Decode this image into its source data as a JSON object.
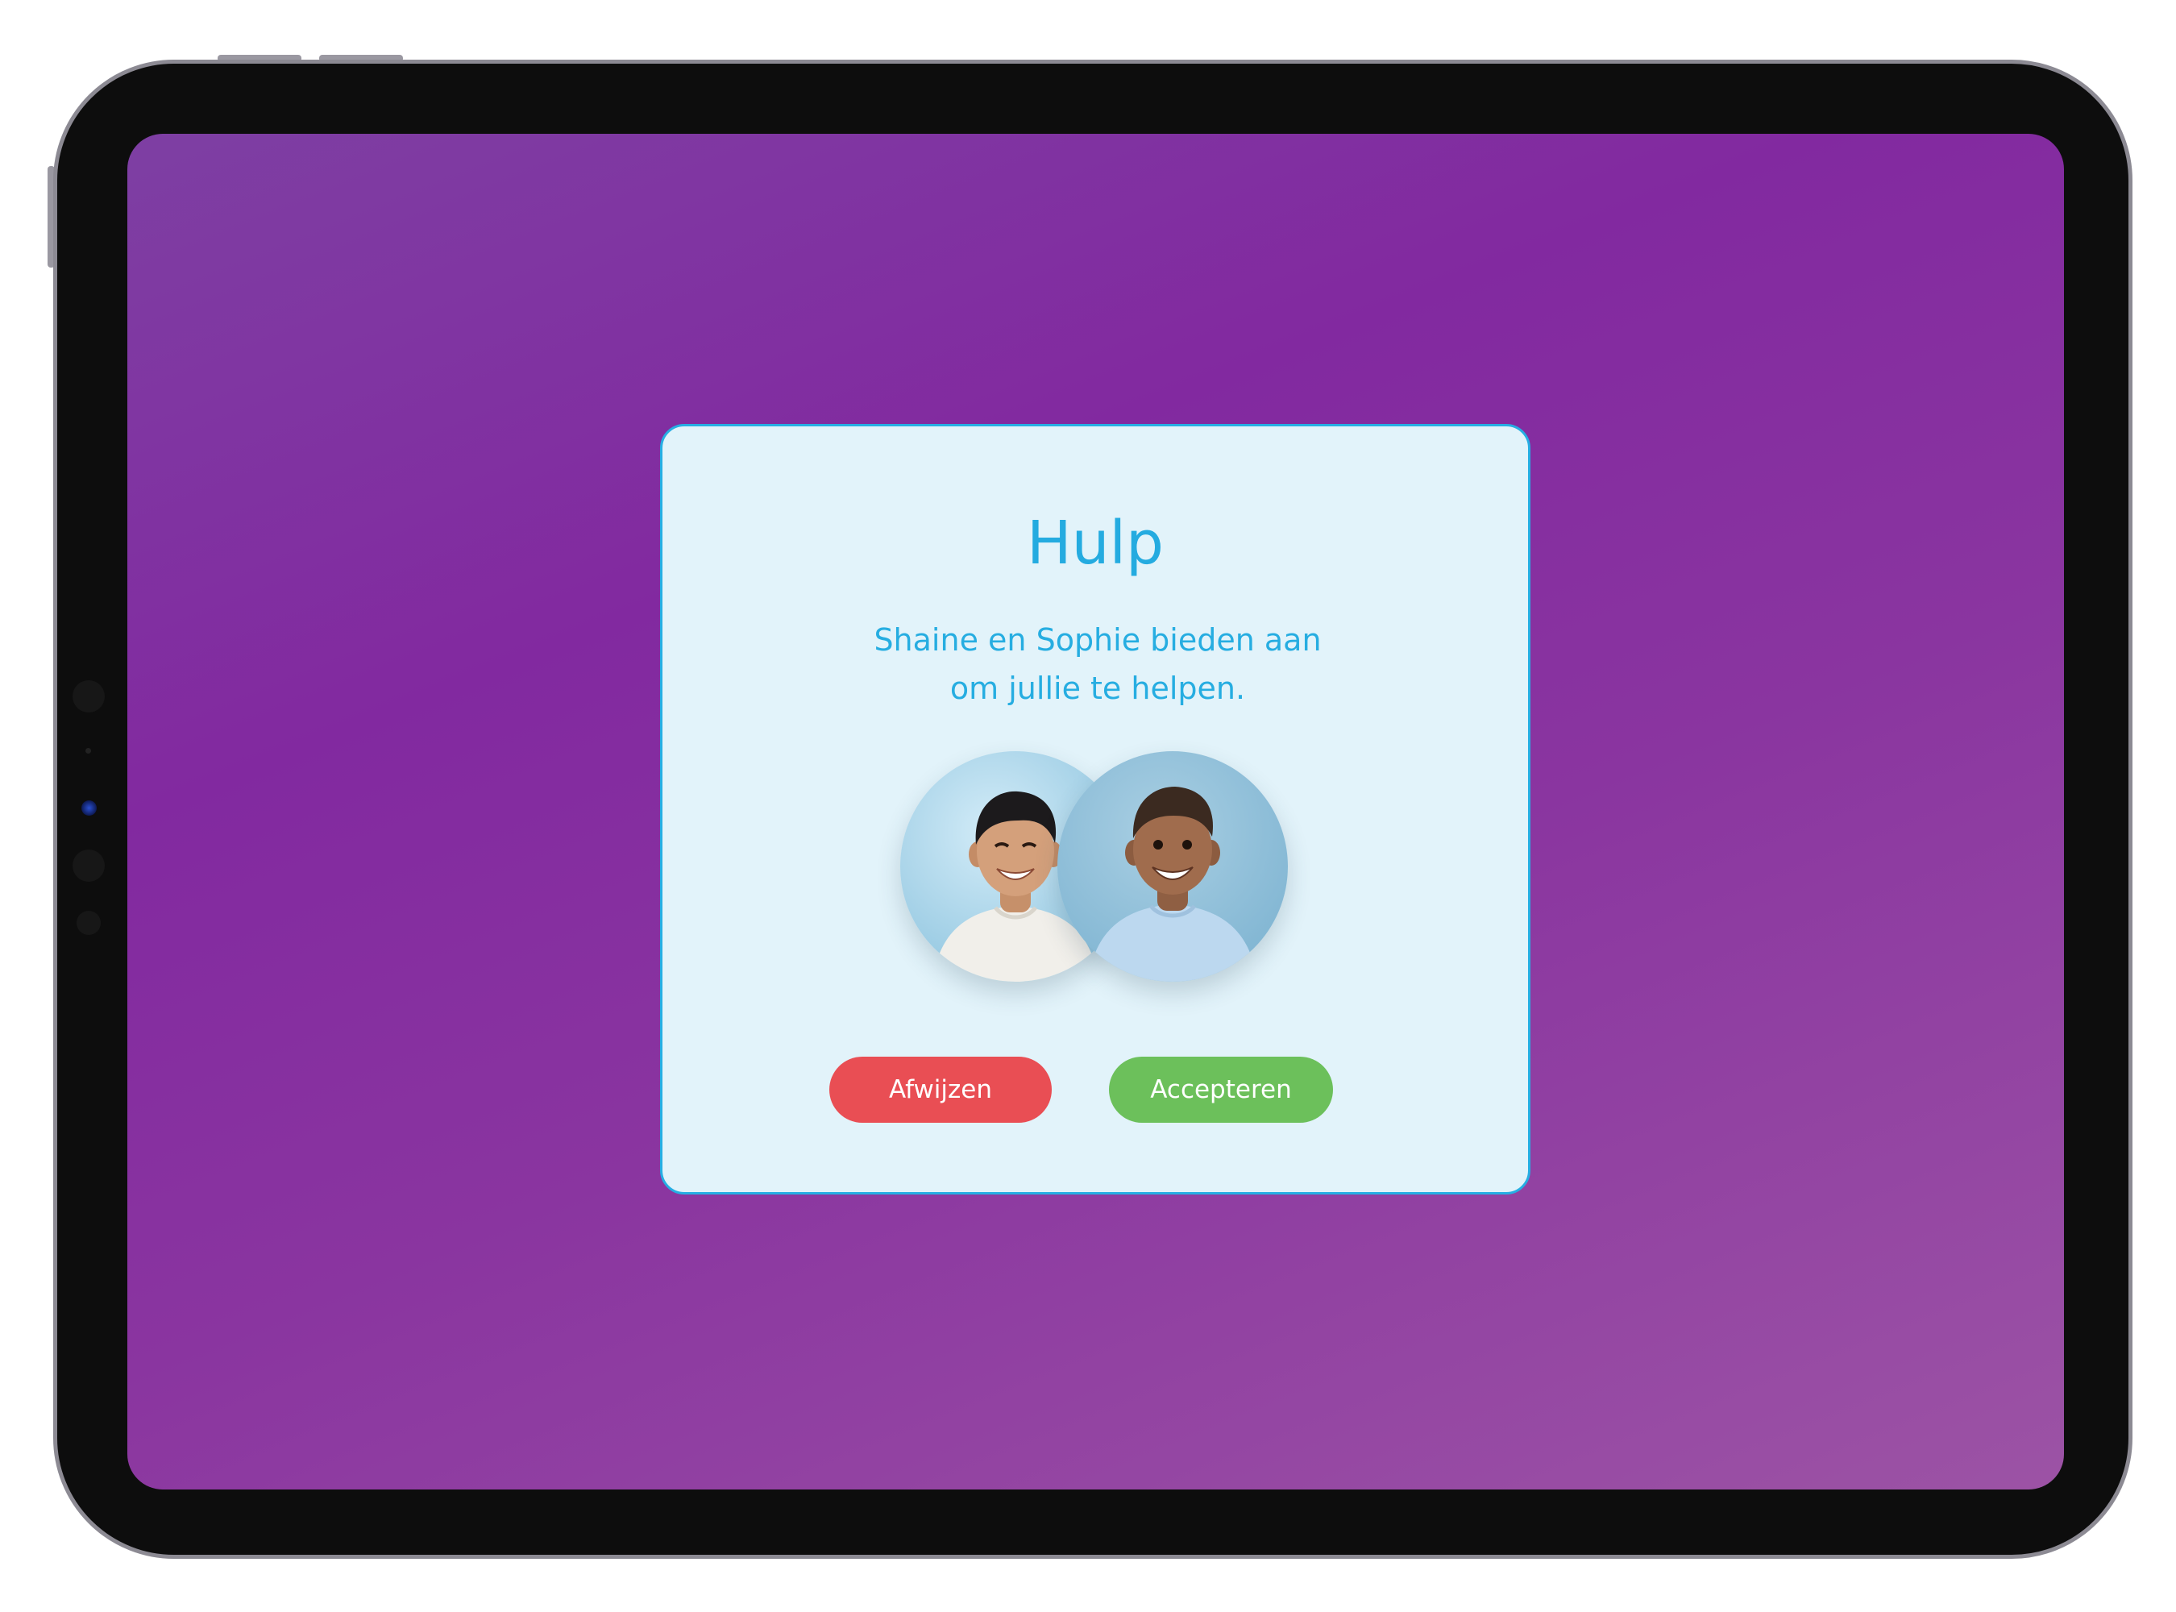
{
  "dialog": {
    "title": "Hulp",
    "message_line1": "Shaine en Sophie bieden aan",
    "message_line2": "om jullie te helpen.",
    "avatars": [
      {
        "description_icon": "child-photo"
      },
      {
        "description_icon": "child-photo"
      }
    ],
    "decline_label": "Afwijzen",
    "accept_label": "Accepteren"
  },
  "colors": {
    "accent": "#24abe0",
    "dialog_background": "#e2f3fa",
    "decline": "#e94e54",
    "accept": "#6cc05b",
    "screen_background": "#8229a0"
  }
}
